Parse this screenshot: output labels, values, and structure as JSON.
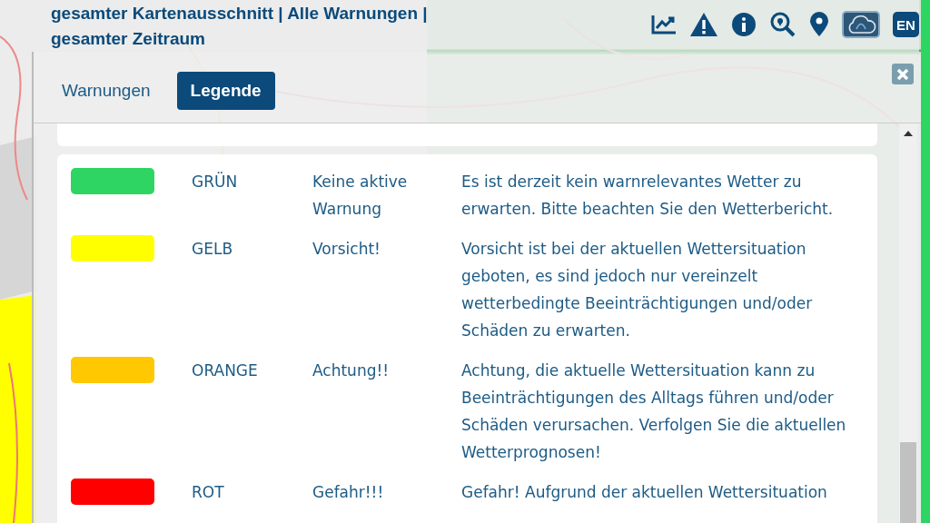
{
  "header": {
    "title": "gesamter Kartenausschnitt | Alle Warnungen | gesamter Zeitraum",
    "tools": [
      {
        "kind": "chart",
        "selected": false
      },
      {
        "kind": "warning",
        "selected": false
      },
      {
        "kind": "info",
        "selected": false
      },
      {
        "kind": "search",
        "selected": false
      },
      {
        "kind": "pin",
        "selected": false
      },
      {
        "kind": "cloud",
        "selected": true
      }
    ],
    "language": "EN"
  },
  "tabs": [
    {
      "label": "Warnungen",
      "selected": false
    },
    {
      "label": "Legende",
      "selected": true
    }
  ],
  "legend": [
    {
      "color": "#2ed562",
      "name": "GRÜN",
      "label": "Keine aktive Warnung",
      "description": "Es ist derzeit kein warnrelevantes Wetter zu erwarten. Bitte beachten Sie den Wetterbericht."
    },
    {
      "color": "#ffff00",
      "name": "GELB",
      "label": "Vorsicht!",
      "description": "Vorsicht ist bei der aktuellen Wettersituation geboten, es sind jedoch nur vereinzelt wetterbedingte Beeinträchtigungen und/oder Schäden zu erwarten."
    },
    {
      "color": "#ffc800",
      "name": "ORANGE",
      "label": "Achtung!!",
      "description": "Achtung, die aktuelle Wettersituation kann zu Beeinträchtigungen des Alltags führen und/oder Schäden verursachen. Verfolgen Sie die aktuellen Wetterprognosen!"
    },
    {
      "color": "#ff0000",
      "name": "ROT",
      "label": "Gefahr!!!",
      "description": "Gefahr! Aufgrund der aktuellen Wettersituation"
    }
  ]
}
